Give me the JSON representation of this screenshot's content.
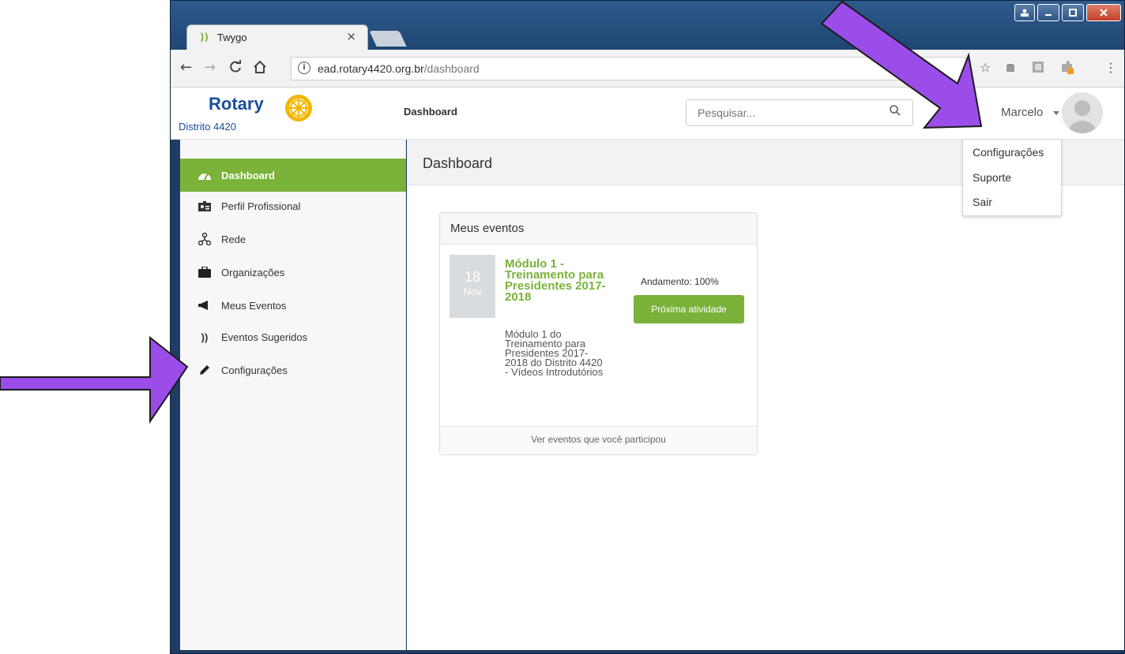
{
  "browser": {
    "tab_title": "Twygo",
    "tab_icon": "))",
    "tab_close": "×",
    "url_host": "ead.rotary4420.org.br",
    "url_path": "/dashboard"
  },
  "app": {
    "logo_word": "Rotary",
    "logo_district": "Distrito 4420",
    "header_title": "Dashboard",
    "search_placeholder": "Pesquisar...",
    "user_name": "Marcelo"
  },
  "user_menu": {
    "items": [
      {
        "label": "Configurações"
      },
      {
        "label": "Suporte"
      },
      {
        "label": "Sair"
      }
    ]
  },
  "sidebar": {
    "items": [
      {
        "label": "Dashboard",
        "icon": "speedometer-icon",
        "active": true
      },
      {
        "label": "Perfil Profissional",
        "icon": "id-card-icon"
      },
      {
        "label": "Rede",
        "icon": "network-icon"
      },
      {
        "label": "Organizações",
        "icon": "briefcase-icon"
      },
      {
        "label": "Meus Eventos",
        "icon": "megaphone-icon"
      },
      {
        "label": "Eventos Sugeridos",
        "icon": "signal-icon",
        "glyph": "))"
      },
      {
        "label": "Configurações",
        "icon": "pencil-icon"
      }
    ]
  },
  "main": {
    "page_title": "Dashboard",
    "card": {
      "title": "Meus eventos",
      "event": {
        "day": "18",
        "month": "Nov",
        "title": "Módulo 1 - Treinamento para Presidentes 2017-2018",
        "description": "Módulo 1 do Treinamento para Presidentes 2017-2018 do Distrito 4420 - Vídeos Introdutórios",
        "progress": "Andamento: 100%",
        "progress_value": 100,
        "button": "Próxima atividade"
      },
      "footer_link": "Ver eventos que você participou"
    }
  },
  "colors": {
    "accent": "#7ab23a",
    "brand_blue": "#1a4e9c",
    "arrow_purple": "#9b4dea"
  }
}
